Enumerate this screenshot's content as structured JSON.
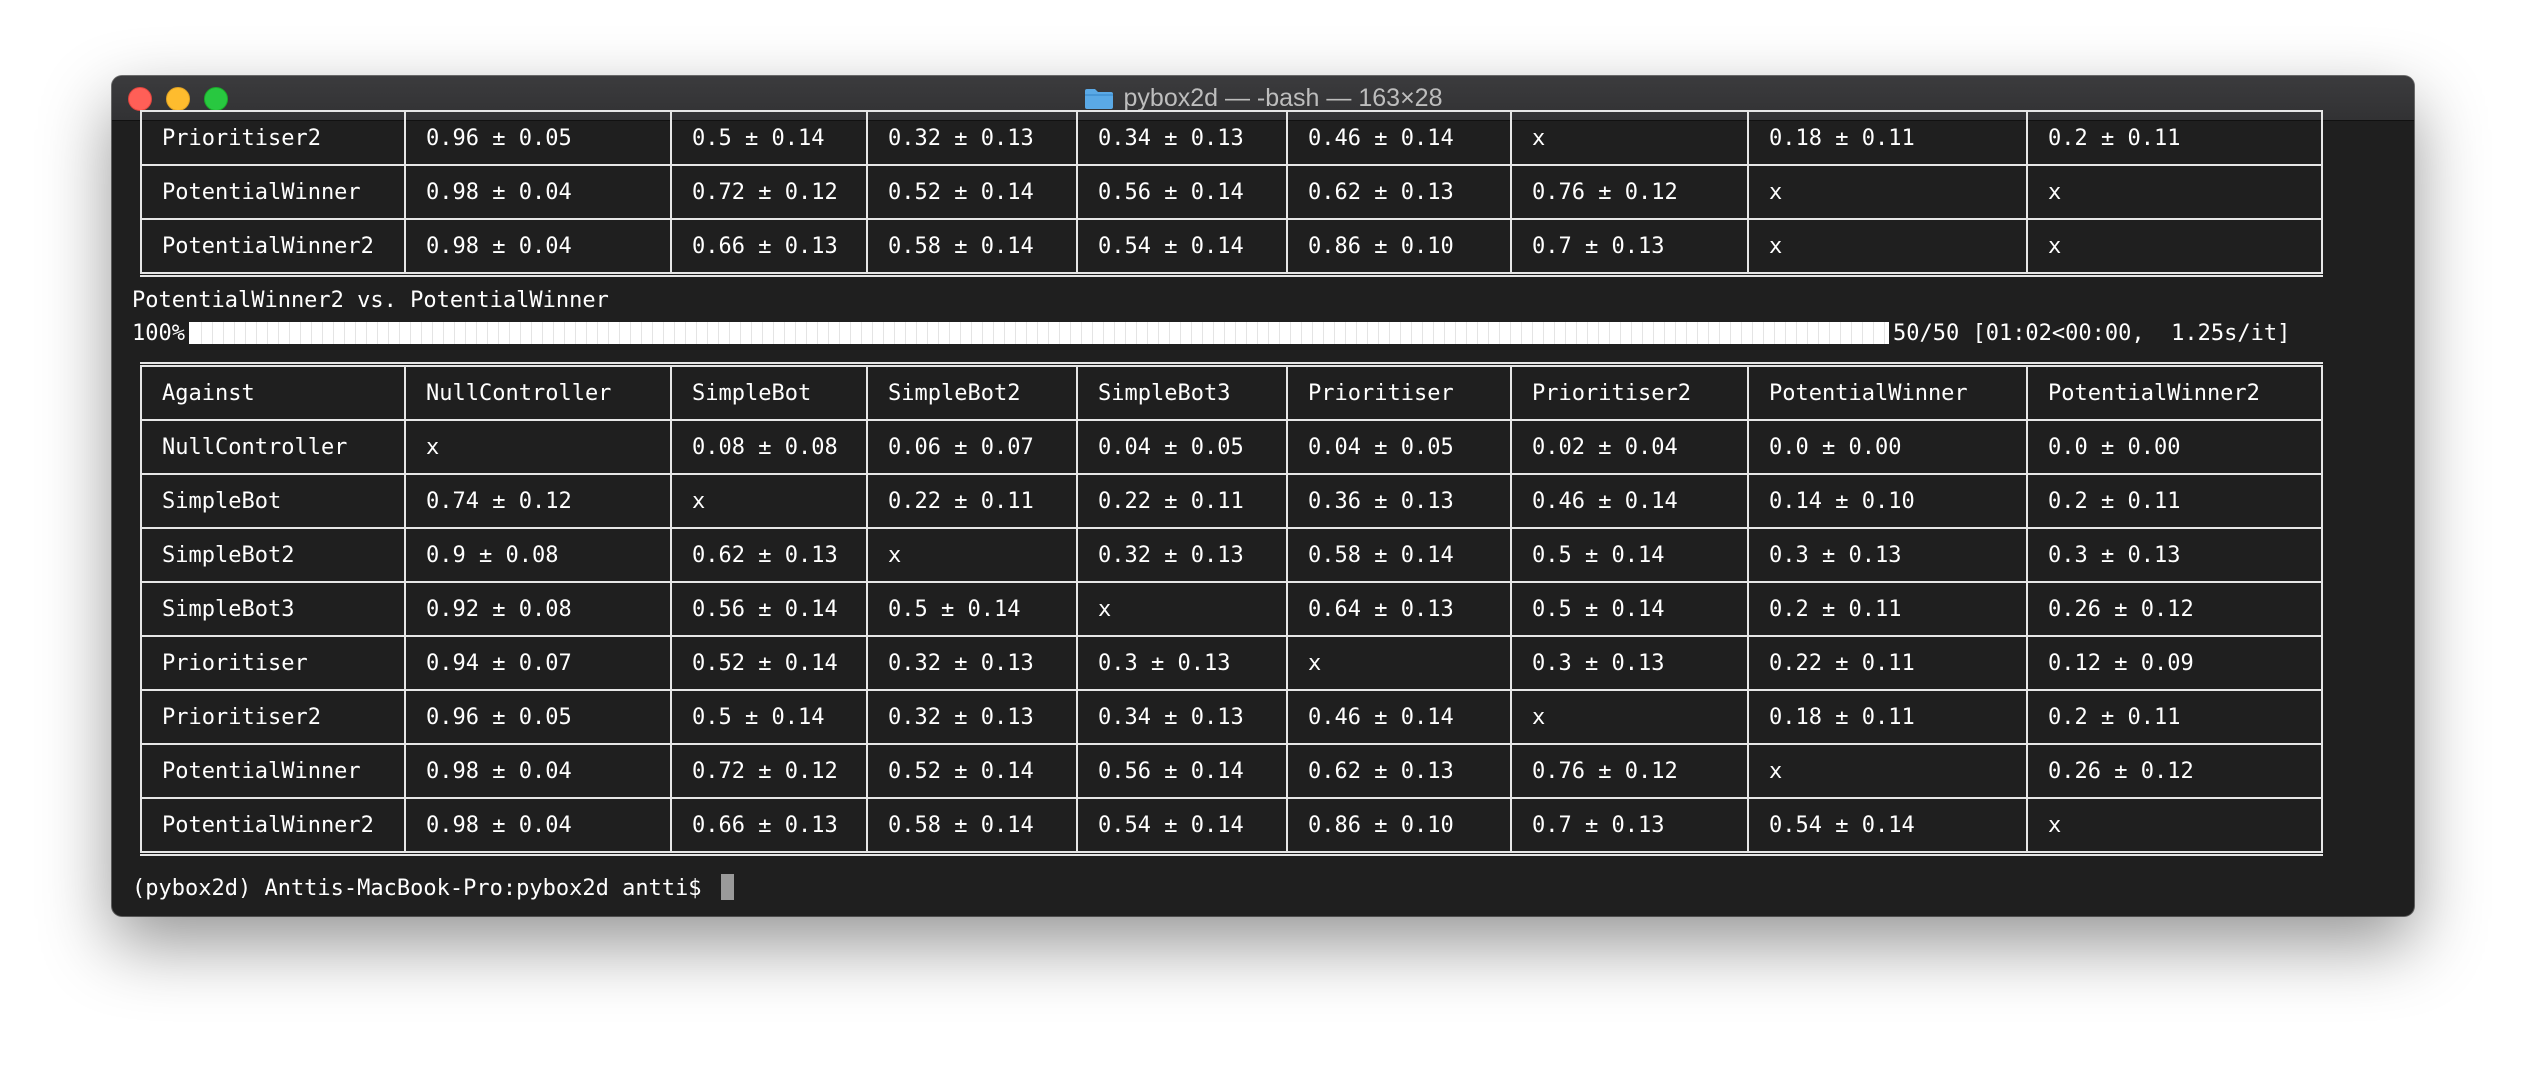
{
  "window": {
    "title": "pybox2d — -bash — 163×28"
  },
  "top_table": {
    "rows": [
      [
        "Prioritiser2",
        "0.96 ± 0.05",
        "0.5 ± 0.14",
        "0.32 ± 0.13",
        "0.34 ± 0.13",
        "0.46 ± 0.14",
        "x",
        "0.18 ± 0.11",
        "0.2 ± 0.11"
      ],
      [
        "PotentialWinner",
        "0.98 ± 0.04",
        "0.72 ± 0.12",
        "0.52 ± 0.14",
        "0.56 ± 0.14",
        "0.62 ± 0.13",
        "0.76 ± 0.12",
        "x",
        "x"
      ],
      [
        "PotentialWinner2",
        "0.98 ± 0.04",
        "0.66 ± 0.13",
        "0.58 ± 0.14",
        "0.54 ± 0.14",
        "0.86 ± 0.10",
        "0.7 ± 0.13",
        "x",
        "x"
      ]
    ]
  },
  "match_line": "PotentialWinner2 vs. PotentialWinner",
  "progress": {
    "percent_label": "100%",
    "fraction": 1.0,
    "stats": "50/50 [01:02<00:00,  1.25s/it]"
  },
  "results_table": {
    "header": [
      "Against",
      "NullController",
      "SimpleBot",
      "SimpleBot2",
      "SimpleBot3",
      "Prioritiser",
      "Prioritiser2",
      "PotentialWinner",
      "PotentialWinner2"
    ],
    "rows": [
      [
        "NullController",
        "x",
        "0.08 ± 0.08",
        "0.06 ± 0.07",
        "0.04 ± 0.05",
        "0.04 ± 0.05",
        "0.02 ± 0.04",
        "0.0 ± 0.00",
        "0.0 ± 0.00"
      ],
      [
        "SimpleBot",
        "0.74 ± 0.12",
        "x",
        "0.22 ± 0.11",
        "0.22 ± 0.11",
        "0.36 ± 0.13",
        "0.46 ± 0.14",
        "0.14 ± 0.10",
        "0.2 ± 0.11"
      ],
      [
        "SimpleBot2",
        "0.9 ± 0.08",
        "0.62 ± 0.13",
        "x",
        "0.32 ± 0.13",
        "0.58 ± 0.14",
        "0.5 ± 0.14",
        "0.3 ± 0.13",
        "0.3 ± 0.13"
      ],
      [
        "SimpleBot3",
        "0.92 ± 0.08",
        "0.56 ± 0.14",
        "0.5 ± 0.14",
        "x",
        "0.64 ± 0.13",
        "0.5 ± 0.14",
        "0.2 ± 0.11",
        "0.26 ± 0.12"
      ],
      [
        "Prioritiser",
        "0.94 ± 0.07",
        "0.52 ± 0.14",
        "0.32 ± 0.13",
        "0.3 ± 0.13",
        "x",
        "0.3 ± 0.13",
        "0.22 ± 0.11",
        "0.12 ± 0.09"
      ],
      [
        "Prioritiser2",
        "0.96 ± 0.05",
        "0.5 ± 0.14",
        "0.32 ± 0.13",
        "0.34 ± 0.13",
        "0.46 ± 0.14",
        "x",
        "0.18 ± 0.11",
        "0.2 ± 0.11"
      ],
      [
        "PotentialWinner",
        "0.98 ± 0.04",
        "0.72 ± 0.12",
        "0.52 ± 0.14",
        "0.56 ± 0.14",
        "0.62 ± 0.13",
        "0.76 ± 0.12",
        "x",
        "0.26 ± 0.12"
      ],
      [
        "PotentialWinner2",
        "0.98 ± 0.04",
        "0.66 ± 0.13",
        "0.58 ± 0.14",
        "0.54 ± 0.14",
        "0.86 ± 0.10",
        "0.7 ± 0.13",
        "0.54 ± 0.14",
        "x"
      ]
    ]
  },
  "prompt": "(pybox2d) Anttis-MacBook-Pro:pybox2d antti$ "
}
